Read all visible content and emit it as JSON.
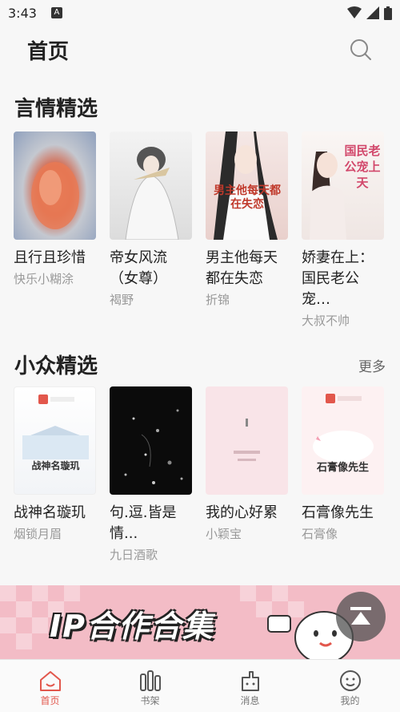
{
  "status_bar": {
    "time": "3:43",
    "notification_icon": "A"
  },
  "header": {
    "title": "首页"
  },
  "sections": [
    {
      "title": "言情精选",
      "books": [
        {
          "title": "且行且珍惜",
          "author": "快乐小糊涂"
        },
        {
          "title": "帝女风流（女尊）",
          "author": "褐野"
        },
        {
          "title": "男主他每天都在失恋",
          "author": "折锦",
          "cover_text": "男主他每天都在失恋"
        },
        {
          "title": "娇妻在上：国民老公宠…",
          "author": "大叔不帅",
          "cover_text": "国民老公宠上天"
        }
      ]
    },
    {
      "title": "小众精选",
      "more": "更多",
      "books": [
        {
          "title": "战神名璇玑",
          "author": "烟锁月眉",
          "cover_text": "战神名璇玑"
        },
        {
          "title": "句.逗.皆是情...",
          "author": "九日酒歌"
        },
        {
          "title": "我的心好累",
          "author": "小颖宝"
        },
        {
          "title": "石膏像先生",
          "author": "石膏像",
          "cover_text": "石膏像先生"
        }
      ]
    }
  ],
  "banner": {
    "text": "IP合作合集"
  },
  "tabs": [
    {
      "label": "首页",
      "icon": "home-icon",
      "active": true
    },
    {
      "label": "书架",
      "icon": "bookshelf-icon"
    },
    {
      "label": "消息",
      "icon": "message-icon"
    },
    {
      "label": "我的",
      "icon": "profile-icon"
    }
  ],
  "colors": {
    "accent": "#e2574c",
    "background": "#f7f7f7"
  }
}
